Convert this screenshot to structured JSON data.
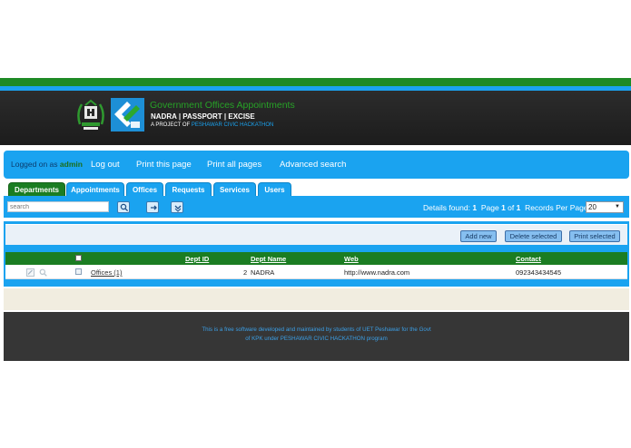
{
  "header": {
    "title": "Government Offices Appointments",
    "subtitle": "NADRA | PASSPORT | EXCISE",
    "project_prefix": "A PROJECT OF",
    "project_name": "PESHAWAR CIVIC HACKATHON",
    "colors": {
      "green": "#1e8a25",
      "blue": "#1aa3f0",
      "dark": "#262626"
    }
  },
  "nav": {
    "logged_prefix": "Logged on as",
    "user": "admin",
    "links": [
      "Log out",
      "Print this page",
      "Print all pages",
      "Advanced search"
    ]
  },
  "tabs": [
    "Departments",
    "Appointments",
    "Offices",
    "Requests",
    "Services",
    "Users"
  ],
  "active_tab": "Departments",
  "toolbar": {
    "search_placeholder": "search",
    "details_label": "Details found:",
    "details_count": "1",
    "page_label": "Page",
    "page_current": "1",
    "page_of": "of",
    "page_total": "1",
    "rpp_label": "Records Per Page:",
    "rpp_value": "20",
    "icons": [
      "search-icon",
      "reset-icon",
      "toggle-filter-icon"
    ]
  },
  "actions": {
    "add": "Add new",
    "delete": "Delete selected",
    "print": "Print selected"
  },
  "table": {
    "columns": [
      "Dept ID",
      "Dept Name",
      "Web",
      "Contact"
    ],
    "rows": [
      {
        "link": "Offices (1)",
        "id": "2",
        "name": "NADRA",
        "web": "http://www.nadra.com",
        "contact": "092343434545"
      }
    ]
  },
  "footer": {
    "line1": "This is a free software developed and maintained by students of UET Peshawar for the Govt",
    "line2": "of KPK under PESHAWAR CIVIC HACKATHON program"
  }
}
